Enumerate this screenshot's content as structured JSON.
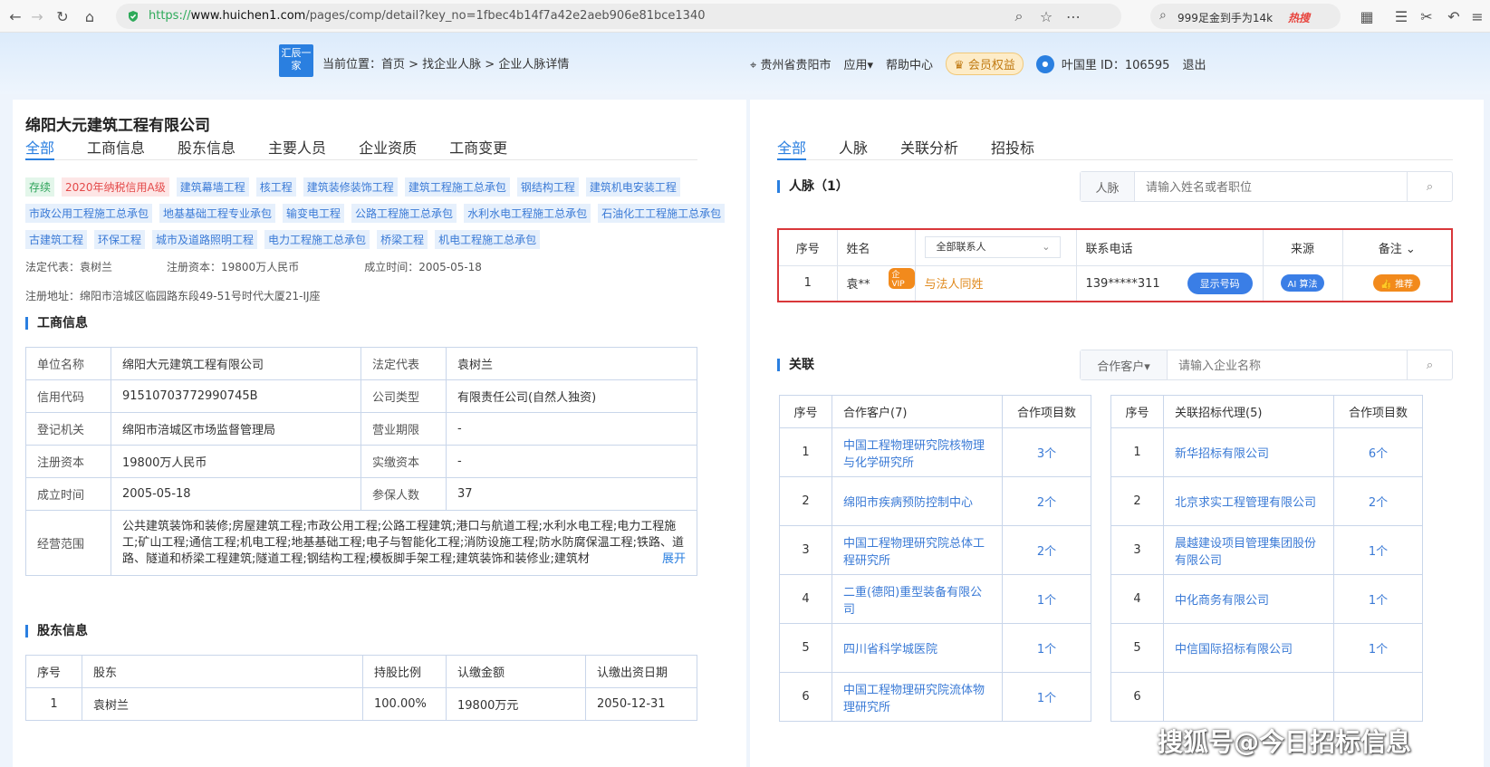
{
  "browser": {
    "url_prefix": "https://",
    "url_host": "www.huichen1.com",
    "url_path": "/pages/comp/detail?key_no=1fbec4b14f7a42e2aeb906e81bce1340",
    "search_text": "999足金到手为14k",
    "hot_label": "热搜"
  },
  "header": {
    "logo_text": "汇辰一家",
    "breadcrumb": "当前位置：首页 > 找企业人脉 > 企业人脉详情",
    "location": "贵州省贵阳市",
    "apps": "应用▾",
    "help": "帮助中心",
    "member": "会员权益",
    "user": "叶国里 ID：106595",
    "logout": "退出"
  },
  "left": {
    "company_name": "绵阳大元建筑工程有限公司",
    "tabs": [
      "全部",
      "工商信息",
      "股东信息",
      "主要人员",
      "企业资质",
      "工商变更"
    ],
    "status_tag": "存续",
    "credit_tag": "2020年纳税信用A级",
    "tags": [
      "建筑幕墙工程",
      "核工程",
      "建筑装修装饰工程",
      "建筑工程施工总承包",
      "钢结构工程",
      "建筑机电安装工程",
      "市政公用工程施工总承包",
      "地基基础工程专业承包",
      "输变电工程",
      "公路工程施工总承包",
      "水利水电工程施工总承包",
      "石油化工工程施工总承包",
      "古建筑工程",
      "环保工程",
      "城市及道路照明工程",
      "电力工程施工总承包",
      "桥梁工程",
      "机电工程施工总承包"
    ],
    "legal_rep_line": "法定代表：袁树兰",
    "capital_line": "注册资本：19800万人民币",
    "founded_line": "成立时间：2005-05-18",
    "address_line": "注册地址：绵阳市涪城区临园路东段49-51号时代大厦21-IJ座",
    "biz_title": "工商信息",
    "biz": {
      "name_label": "单位名称",
      "name_value": "绵阳大元建筑工程有限公司",
      "rep_label": "法定代表",
      "rep_value": "袁树兰",
      "code_label": "信用代码",
      "code_value": "91510703772990745B",
      "type_label": "公司类型",
      "type_value": "有限责任公司(自然人独资)",
      "org_label": "登记机关",
      "org_value": "绵阳市涪城区市场监督管理局",
      "term_label": "营业期限",
      "term_value": "-",
      "cap_label": "注册资本",
      "cap_value": "19800万人民币",
      "paid_label": "实缴资本",
      "paid_value": "-",
      "date_label": "成立时间",
      "date_value": "2005-05-18",
      "ins_label": "参保人数",
      "ins_value": "37",
      "scope_label": "经营范围",
      "scope_value": "公共建筑装饰和装修;房屋建筑工程;市政公用工程;公路工程建筑;港口与航道工程;水利水电工程;电力工程施工;矿山工程;通信工程;机电工程;地基基础工程;电子与智能化工程;消防设施工程;防水防腐保温工程;铁路、道路、隧道和桥梁工程建筑;隧道工程;钢结构工程;模板脚手架工程;建筑装饰和装修业;建筑材",
      "expand": "展开"
    },
    "share_title": "股东信息",
    "share_headers": [
      "序号",
      "股东",
      "持股比例",
      "认缴金额",
      "认缴出资日期"
    ],
    "share_rows": [
      [
        "1",
        "袁树兰",
        "100.00%",
        "19800万元",
        "2050-12-31"
      ]
    ]
  },
  "right": {
    "tabs": [
      "全部",
      "人脉",
      "关联分析",
      "招投标"
    ],
    "contacts_title": "人脉（1）",
    "contacts_cat": "人脉",
    "contacts_placeholder": "请输入姓名或者职位",
    "c_headers": {
      "no": "序号",
      "name": "姓名",
      "filter": "全部联系人",
      "phone": "联系电话",
      "source": "来源",
      "note": "备注"
    },
    "contact": {
      "no": "1",
      "name": "袁**",
      "vip": "企VIP",
      "relation": "与法人同姓",
      "phone": "139*****311",
      "show_btn": "显示号码",
      "source": "算法",
      "note": "推荐"
    },
    "rel_title": "关联",
    "rel_cat": "合作客户▾",
    "rel_placeholder": "请输入企业名称",
    "clients_headers": [
      "序号",
      "合作客户(7)",
      "合作项目数"
    ],
    "clients": [
      [
        "1",
        "中国工程物理研究院核物理与化学研究所",
        "3个"
      ],
      [
        "2",
        "绵阳市疾病预防控制中心",
        "2个"
      ],
      [
        "3",
        "中国工程物理研究院总体工程研究所",
        "2个"
      ],
      [
        "4",
        "二重(德阳)重型装备有限公司",
        "1个"
      ],
      [
        "5",
        "四川省科学城医院",
        "1个"
      ],
      [
        "6",
        "中国工程物理研究院流体物理研究所",
        "1个"
      ]
    ],
    "agents_headers": [
      "序号",
      "关联招标代理(5)",
      "合作项目数"
    ],
    "agents": [
      [
        "1",
        "新华招标有限公司",
        "6个"
      ],
      [
        "2",
        "北京求实工程管理有限公司",
        "2个"
      ],
      [
        "3",
        "晨越建设项目管理集团股份有限公司",
        "1个"
      ],
      [
        "4",
        "中化商务有限公司",
        "1个"
      ],
      [
        "5",
        "中信国际招标有限公司",
        "1个"
      ],
      [
        "6",
        "",
        ""
      ]
    ]
  },
  "watermark": "搜狐号@今日招标信息"
}
